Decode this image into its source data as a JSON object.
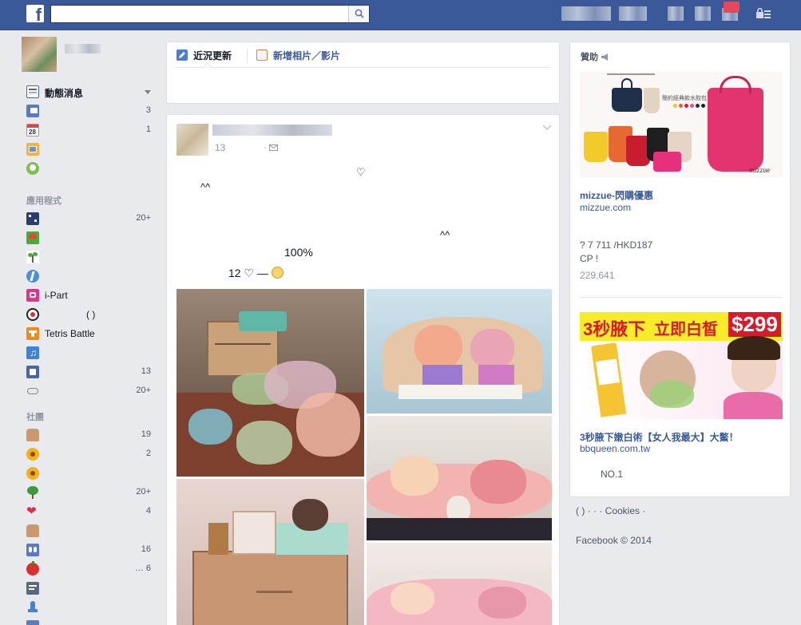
{
  "topbar": {
    "logo": "f",
    "search_placeholder": "",
    "search_icon": "search-icon",
    "settings_icon": "lock-icon"
  },
  "left_nav": {
    "favorites": [
      {
        "label": "動態消息",
        "count": "",
        "icon": "news-feed-icon"
      },
      {
        "label": "",
        "count": "3",
        "icon": "messages-icon"
      },
      {
        "label": "",
        "count": "1",
        "icon": "events-icon"
      },
      {
        "label": "",
        "count": "",
        "icon": "photos-icon"
      },
      {
        "label": "",
        "count": "",
        "icon": "friends-icon"
      }
    ],
    "apps_title": "應用程式",
    "apps": [
      {
        "label": "",
        "count": "20+",
        "icon": "app-games-icon"
      },
      {
        "label": "",
        "count": "",
        "icon": "app-farm-icon"
      },
      {
        "label": "",
        "count": "",
        "icon": "app-plant-icon"
      },
      {
        "label": "",
        "count": "",
        "icon": "app-blue-icon"
      },
      {
        "label": "i-Part",
        "count": "",
        "icon": "ipart-icon"
      },
      {
        "label": "(           )",
        "count": "",
        "icon": "soccer-icon"
      },
      {
        "label": "Tetris Battle",
        "count": "",
        "icon": "tetris-icon"
      },
      {
        "label": "",
        "count": "",
        "icon": "music-icon"
      },
      {
        "label": "",
        "count": "13",
        "icon": "pages-feed-icon"
      },
      {
        "label": "",
        "count": "20+",
        "icon": "gamepad-icon"
      }
    ],
    "groups_title": "社團",
    "groups": [
      {
        "label": "",
        "count": "19",
        "icon": "group-fist-icon"
      },
      {
        "label": "",
        "count": "2",
        "icon": "sunflower-icon"
      },
      {
        "label": "",
        "count": "",
        "icon": "sunflower-icon"
      },
      {
        "label": "",
        "count": "20+",
        "icon": "tree-icon"
      },
      {
        "label": "",
        "count": "4",
        "icon": "heart-icon"
      },
      {
        "label": "",
        "count": "",
        "icon": "group-fist-icon"
      },
      {
        "label": "",
        "count": "16",
        "icon": "group-people-icon"
      },
      {
        "label": "",
        "count": "…   6",
        "icon": "apple-icon"
      },
      {
        "label": "",
        "count": "",
        "icon": "notes-icon"
      },
      {
        "label": "",
        "count": "",
        "icon": "rocket-icon"
      }
    ]
  },
  "composer": {
    "status_tab": "近況更新",
    "photo_tab": "新增相片／影片"
  },
  "post": {
    "time": "13",
    "privacy_dot": "·",
    "lines": [
      "♡",
      "^^",
      "^^",
      "100%",
      "12    ♡ —"
    ]
  },
  "right": {
    "sponsor_title": "贊助",
    "ad1": {
      "title": "mizzue-閃購優惠",
      "domain": "mizzue.com",
      "body_line1": "?        7                         711    /HKD187",
      "body_line2": "CP                !",
      "likes": "229,641",
      "image_brand": "mizzue",
      "image_caption": "簡約經典款水餃包"
    },
    "ad2": {
      "banner_left": "3秒腋下",
      "banner_mid": "立即白皙",
      "banner_price": "$299",
      "title": "3秒腋下嫩白術【女人我最大】大鱉！",
      "domain": "bbqueen.com.tw",
      "body": "NO.1"
    },
    "footer_links": "(      )  ·                      ·                    · Cookies  ·",
    "footer_copy": "Facebook © 2014"
  },
  "colors": {
    "topbar": "#3b5998",
    "link": "#3b5998",
    "page_bg": "#e9eaed"
  }
}
